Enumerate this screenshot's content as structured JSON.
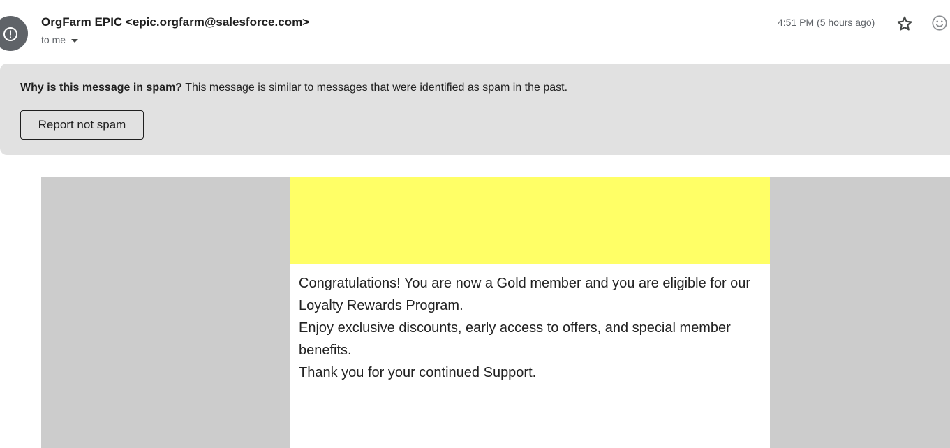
{
  "header": {
    "sender": "OrgFarm EPIC <epic.orgfarm@salesforce.com>",
    "recipient": "to me",
    "timestamp": "4:51 PM (5 hours ago)",
    "icons": {
      "avatar": "spam-warning-icon",
      "star": "star-icon",
      "emoji": "emoji-react-icon",
      "recipient_toggle": "chevron-down-icon"
    }
  },
  "spam_banner": {
    "title": "Why is this message in spam?",
    "description": " This message is similar to messages that were identified as spam in the past.",
    "button_label": "Report not spam"
  },
  "email_body": {
    "lines": [
      "Congratulations! You are now a Gold member and you are eligible for our Loyalty Rewards Program.",
      "Enjoy exclusive discounts, early access to offers, and special member benefits.",
      "Thank you for your continued Support."
    ]
  },
  "colors": {
    "banner_yellow": "#ffff66",
    "spam_banner_bg": "#e1e1e1",
    "frame_gray": "#cccccc",
    "avatar_gray": "#5f6368"
  }
}
